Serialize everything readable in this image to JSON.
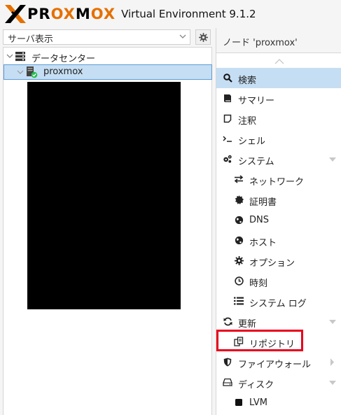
{
  "header": {
    "logo_text_prefix": "PR",
    "logo_text_ox1": "OX",
    "logo_text_mid": "M",
    "logo_text_ox2": "OX",
    "version_text": "Virtual Environment 9.1.2"
  },
  "left": {
    "view_select_value": "サーバ表示",
    "tree": [
      {
        "label": "データセンター",
        "icon": "server-stack-icon"
      },
      {
        "label": "proxmox",
        "icon": "host-online-icon"
      }
    ]
  },
  "right": {
    "node_title": "ノード 'proxmox'",
    "menu": [
      {
        "label": "検索",
        "icon": "search-icon",
        "active": true
      },
      {
        "label": "サマリー",
        "icon": "book-icon"
      },
      {
        "label": "注釈",
        "icon": "note-icon"
      },
      {
        "label": "シェル",
        "icon": "terminal-icon"
      },
      {
        "label": "システム",
        "icon": "gears-icon",
        "expandable": true
      },
      {
        "label": "ネットワーク",
        "icon": "exchange-icon"
      },
      {
        "label": "証明書",
        "icon": "certificate-icon"
      },
      {
        "label": "DNS",
        "icon": "globe-icon"
      },
      {
        "label": "ホスト",
        "icon": "globe-icon"
      },
      {
        "label": "オプション",
        "icon": "gear-icon"
      },
      {
        "label": "時刻",
        "icon": "clock-icon"
      },
      {
        "label": "システム ログ",
        "icon": "list-icon"
      },
      {
        "label": "更新",
        "icon": "refresh-icon",
        "expandable": true
      },
      {
        "label": "リポジトリ",
        "icon": "files-icon",
        "highlighted": true
      },
      {
        "label": "ファイアウォール",
        "icon": "shield-icon",
        "submenu": true
      },
      {
        "label": "ディスク",
        "icon": "hdd-icon",
        "expandable": true
      },
      {
        "label": "LVM",
        "icon": "square-icon"
      }
    ]
  },
  "colors": {
    "accent_orange": "#e57000",
    "selection_blue": "#c5def3",
    "highlight_red": "#e8001c",
    "online_green": "#21bf4b"
  }
}
